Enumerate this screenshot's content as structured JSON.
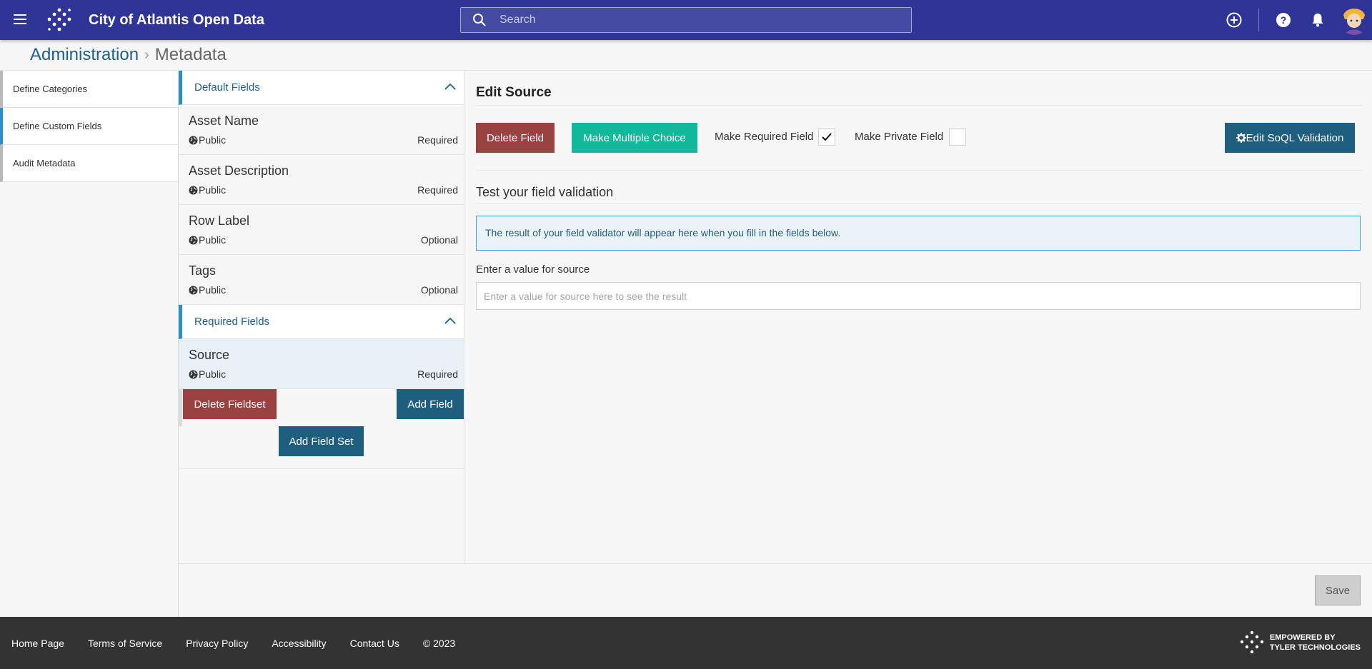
{
  "header": {
    "title": "City of Atlantis Open Data",
    "search_placeholder": "Search",
    "brand_color": "#2f3597"
  },
  "breadcrumb": {
    "parent": "Administration",
    "current": "Metadata"
  },
  "sidebar": {
    "items": [
      {
        "label": "Define Categories",
        "active": false
      },
      {
        "label": "Define Custom Fields",
        "active": true
      },
      {
        "label": "Audit Metadata",
        "active": false
      }
    ]
  },
  "fieldsets": {
    "default": {
      "title": "Default Fields",
      "fields": [
        {
          "name": "Asset Name",
          "visibility": "Public",
          "requirement": "Required"
        },
        {
          "name": "Asset Description",
          "visibility": "Public",
          "requirement": "Required"
        },
        {
          "name": "Row Label",
          "visibility": "Public",
          "requirement": "Optional"
        },
        {
          "name": "Tags",
          "visibility": "Public",
          "requirement": "Optional"
        }
      ]
    },
    "required": {
      "title": "Required Fields",
      "fields": [
        {
          "name": "Source",
          "visibility": "Public",
          "requirement": "Required",
          "selected": true
        }
      ]
    },
    "delete_fieldset_label": "Delete Fieldset",
    "add_field_label": "Add Field",
    "add_field_set_label": "Add Field Set"
  },
  "editor": {
    "title": "Edit Source",
    "delete_field_label": "Delete Field",
    "make_multiple_choice_label": "Make Multiple Choice",
    "make_required_label": "Make Required Field",
    "make_required_checked": true,
    "make_private_label": "Make Private Field",
    "make_private_checked": false,
    "edit_soql_label": "Edit SoQL Validation",
    "test_title": "Test your field validation",
    "result_text": "The result of your field validator will appear here when you fill in the fields below.",
    "value_label": "Enter a value for source",
    "value_placeholder": "Enter a value for source here to see the result",
    "value": ""
  },
  "save_label": "Save",
  "footer": {
    "links": [
      "Home Page",
      "Terms of Service",
      "Privacy Policy",
      "Accessibility",
      "Contact Us"
    ],
    "copyright": "© 2023",
    "powered_line1": "EMPOWERED BY",
    "powered_line2": "TYLER TECHNOLOGIES"
  },
  "colors": {
    "accent": "#2b8fc4",
    "link": "#1f5f8b",
    "danger": "#9a4141",
    "primary_button": "#1e5f80",
    "teal_button": "#12b89a",
    "footer_bg": "#333333"
  }
}
